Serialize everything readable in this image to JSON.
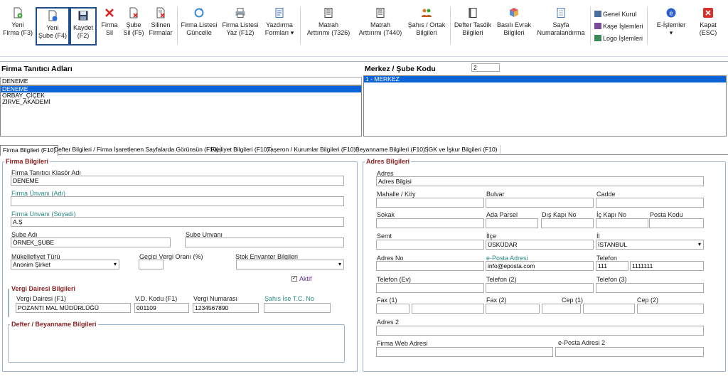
{
  "toolbar": {
    "buttons": [
      {
        "l1": "Yeni",
        "l2": "Firma (F3)"
      },
      {
        "l1": "Yeni",
        "l2": "Şube (F4)"
      },
      {
        "l1": "Kaydet",
        "l2": "(F2)"
      },
      {
        "l1": "Firma",
        "l2": "Sil"
      },
      {
        "l1": "Şube",
        "l2": "Sil (F5)"
      },
      {
        "l1": "Silinen",
        "l2": "Firmalar"
      },
      {
        "l1": "Firma Listesi",
        "l2": "Güncelle"
      },
      {
        "l1": "Firma Listesi",
        "l2": "Yaz (F12)"
      },
      {
        "l1": "Yazdırma",
        "l2": "Formları ▾"
      },
      {
        "l1": "Matrah",
        "l2": "Arttırımı (7326)"
      },
      {
        "l1": "Matrah",
        "l2": "Arttırımı (7440)"
      },
      {
        "l1": "Şahıs / Ortak",
        "l2": "Bilgileri"
      },
      {
        "l1": "Defter Tasdik",
        "l2": "Bilgileri"
      },
      {
        "l1": "Basılı Evrak",
        "l2": "Bilgileri"
      },
      {
        "l1": "Sayfa",
        "l2": "Numaralandırma"
      },
      {
        "l1": "E-İşlemler",
        "l2": "▾"
      },
      {
        "l1": "Kapat",
        "l2": "(ESC)"
      }
    ],
    "mini": [
      "Genel Kurul",
      "Kaşe İşlemleri",
      "Logo İşlemleri"
    ]
  },
  "firma_list": {
    "title": "Firma Tanıtıcı Adları",
    "search": "DENEME",
    "items": [
      "DENEME",
      "ORBAY_ÇİÇEK",
      "ZİRVE_AKADEMİ"
    ]
  },
  "sube": {
    "title": "Merkez / Şube Kodu",
    "code": "2",
    "items": [
      "1 - MERKEZ"
    ]
  },
  "tabs": [
    "Firma Bilgileri (F10)",
    "Defter Bilgileri / Firma İşaretlenen Sayfalarda Görünsün (F10)",
    "Faaliyet Bilgileri (F10)",
    "Taşeron / Kurumlar Bilgileri (F10)",
    "Beyanname Bilgileri (F10)",
    "SGK ve İşkur Bilgileri (F10)"
  ],
  "firma": {
    "group_title": "Firma Bilgileri",
    "klasor_label": "Firma  Tanıtıcı Klasör Adı",
    "klasor_value": "DENEME",
    "unvan_adi_label": "Firma  Ünvanı (Adı)",
    "unvan_adi_value": "",
    "unvan_soyadi_label": "Firma  Unvanı (Soyadı)",
    "unvan_soyadi_value": "A.Ş",
    "sube_adi_label": "Şube Adı",
    "sube_adi_value": "ÖRNEK_ŞUBE",
    "sube_unvani_label": "Şube Unvanı",
    "sube_unvani_value": "",
    "mukellef_label": "Mükellefiyet Türü",
    "mukellef_value": "Anonim Şirket",
    "gecici_label": "Geçici Vergi Oranı (%)",
    "gecici_value": "",
    "stok_label": "Stok Envanter Bilgileri",
    "stok_value": "",
    "aktif_label": "Aktif",
    "vergi_title": "Vergi Dairesi Bilgileri",
    "vd_label": "Vergi Dairesi (F1)",
    "vd_value": "POZANTI MAL MÜDÜRLÜĞÜ",
    "vdkod_label": "V.D. Kodu (F1)",
    "vdkod_value": "001109",
    "vno_label": "Vergi Numarası",
    "vno_value": "1234567890",
    "tc_label": "Şahıs İse T.C. No",
    "tc_value": "",
    "defter_title": "Defter / Beyanname Bilgileri"
  },
  "adres": {
    "group_title": "Adres Bilgileri",
    "adres_label": "Adres",
    "adres_value": "Adres Bilgisi",
    "mahalle_label": "Mahalle / Köy",
    "bulvar_label": "Bulvar",
    "cadde_label": "Cadde",
    "sokak_label": "Sokak",
    "ada_label": "Ada Parsel",
    "dis_label": "Dış Kapı No",
    "ic_label": "İç Kapı No",
    "posta_label": "Posta Kodu",
    "semt_label": "Semt",
    "ilce_label": "İlçe",
    "ilce_value": "ÜSKÜDAR",
    "il_label": "İl",
    "il_value": "İSTANBUL",
    "adresno_label": "Adres No",
    "eposta_label": "e-Posta Adresi",
    "eposta_value": "info@eposta.com",
    "tel_label": "Telefon",
    "tel_kod": "111",
    "tel_no": "1111111",
    "telev_label": "Telefon (Ev)",
    "tel2_label": "Telefon (2)",
    "tel3_label": "Telefon (3)",
    "fax1_label": "Fax (1)",
    "fax2_label": "Fax (2)",
    "cep1_label": "Cep (1)",
    "cep2_label": "Cep (2)",
    "adres2_label": "Adres 2",
    "web_label": "Firma Web Adresi",
    "eposta2_label": "e-Posta Adresi 2"
  },
  "colors": {
    "selection": "#0a64d8",
    "group_title": "#8a1f1f",
    "teal_label": "#2a8a86",
    "frame": "#1f4e8c"
  }
}
